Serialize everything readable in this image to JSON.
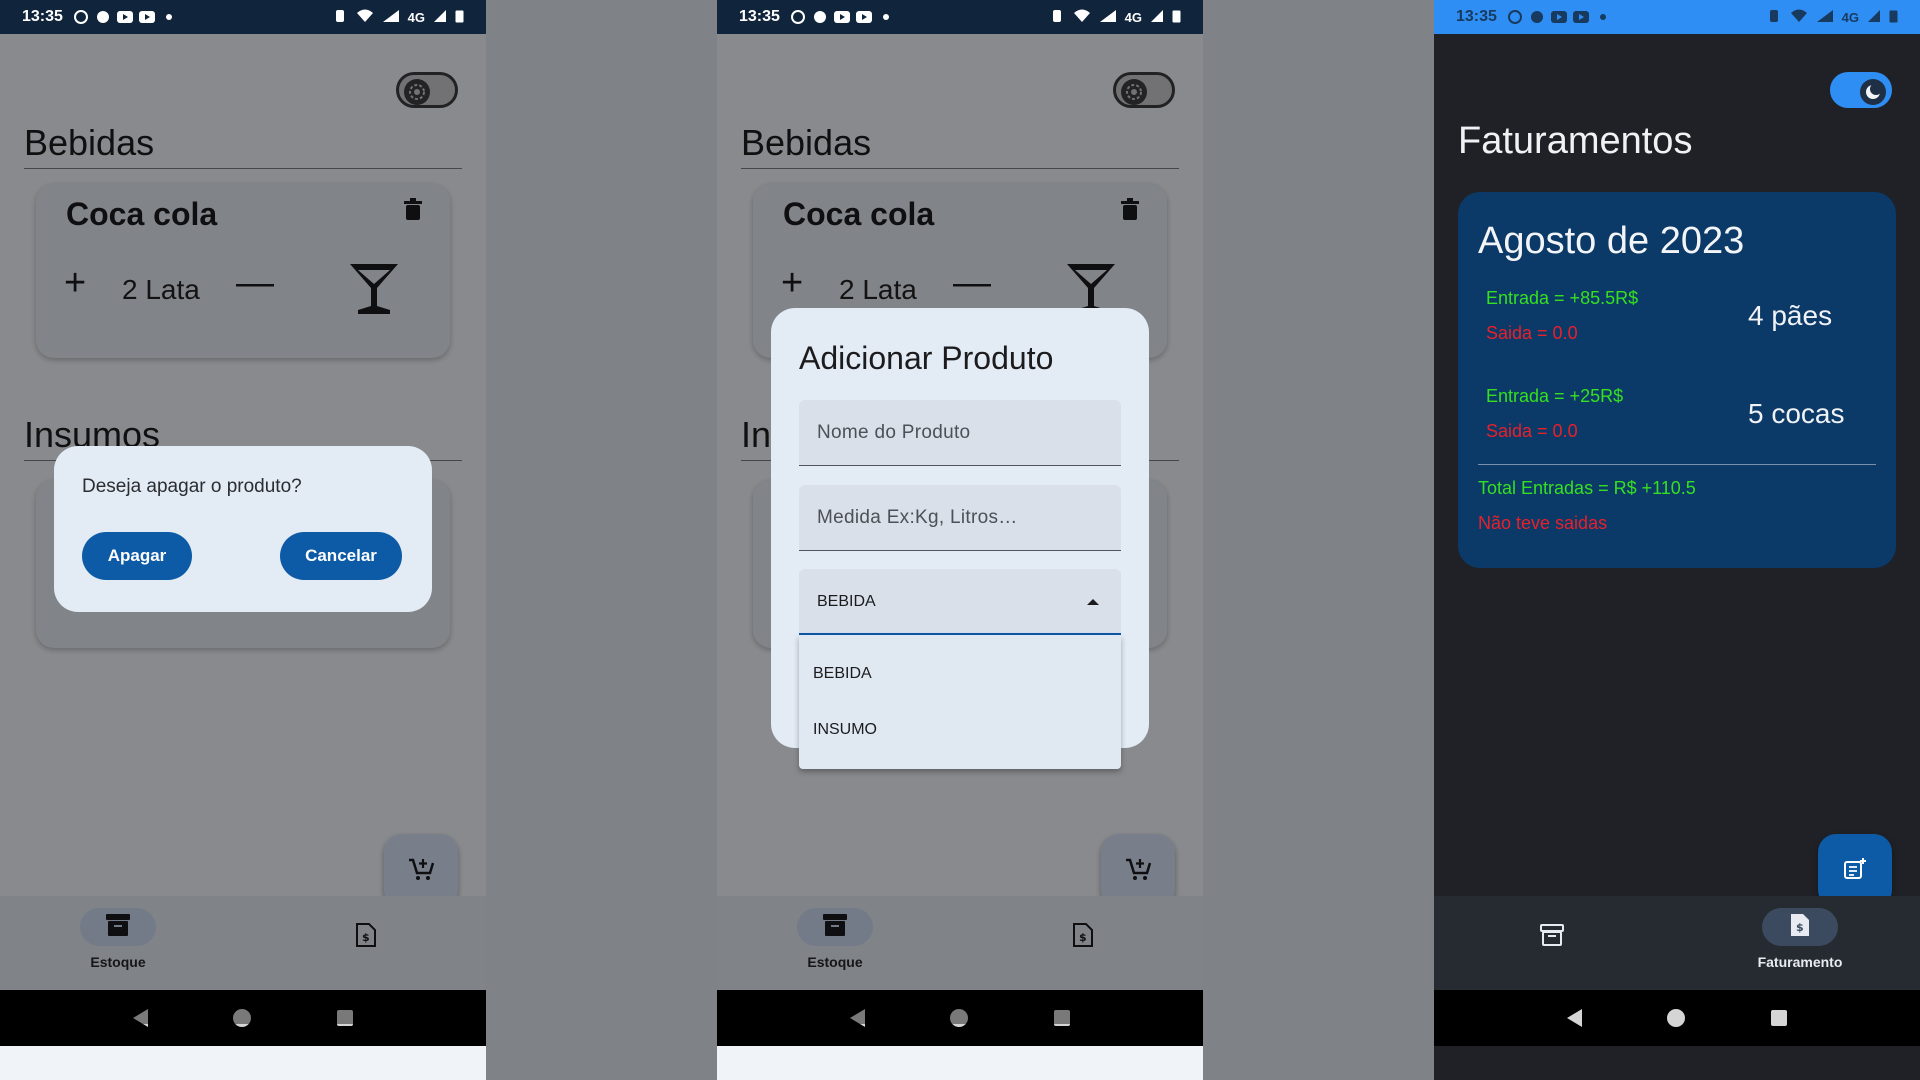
{
  "status_bar": {
    "time": "13:35",
    "network": "4G"
  },
  "stock_screen": {
    "section_bebidas": "Bebidas",
    "section_insumos": "Insumos",
    "product": {
      "name": "Coca cola",
      "quantity": "2 Lata",
      "plus": "+",
      "minus": "—"
    },
    "nav": {
      "estoque_label": "Estoque"
    }
  },
  "delete_dialog": {
    "message": "Deseja apagar o produto?",
    "confirm_label": "Apagar",
    "cancel_label": "Cancelar"
  },
  "add_dialog": {
    "title": "Adicionar Produto",
    "name_placeholder": "Nome do Produto",
    "measure_placeholder": "Medida Ex:Kg, Litros…",
    "category_value": "BEBIDA",
    "category_options": [
      "BEBIDA",
      "INSUMO"
    ]
  },
  "billing_screen": {
    "title": "Faturamentos",
    "month": "Agosto de 2023",
    "entries": [
      {
        "entrada": "Entrada = +85.5R$",
        "saida": "Saida = 0.0",
        "item": "4 pães"
      },
      {
        "entrada": "Entrada = +25R$",
        "saida": "Saida = 0.0",
        "item": "5 cocas"
      }
    ],
    "total_entradas": "Total Entradas = R$ +110.5",
    "saidas_note": "Não teve saidas",
    "nav": {
      "faturamento_label": "Faturamento"
    }
  },
  "colors": {
    "primary": "#0d5aa7",
    "entrada": "#36e01f",
    "saida": "#e8202a",
    "card_dark": "#0b3a68",
    "toggle_on": "#2f8ef4"
  },
  "icons": [
    "whatsapp-icon",
    "youtube-icon",
    "wifi-icon",
    "signal-icon",
    "battery-icon",
    "trash-icon",
    "cocktail-icon",
    "cart-add-icon",
    "archive-icon",
    "invoice-icon",
    "note-add-icon",
    "moon-icon",
    "gear-icon"
  ]
}
